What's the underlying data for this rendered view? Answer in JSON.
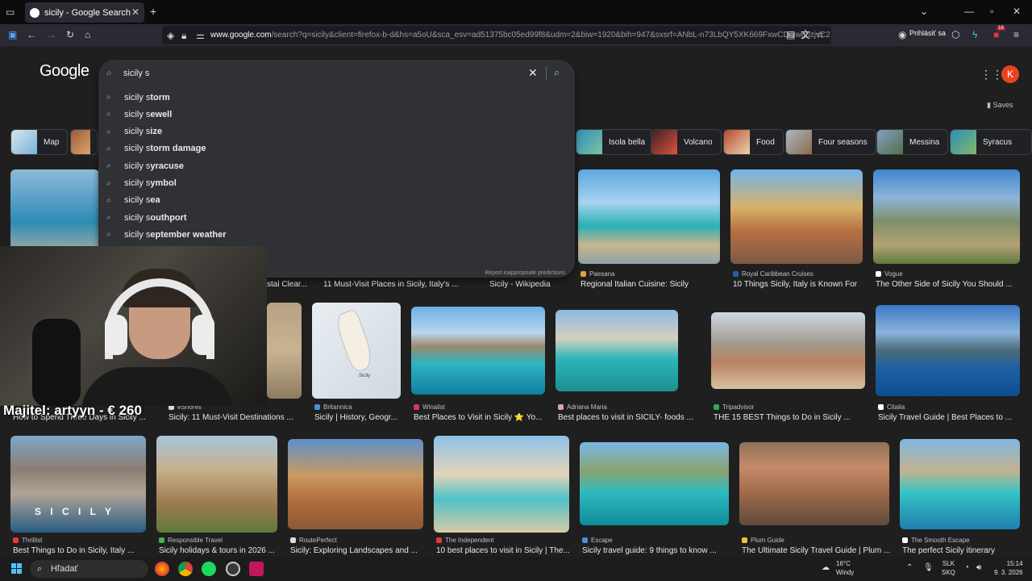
{
  "browser": {
    "tab_title": "sicily - Google Search",
    "url_host": "www.google.com",
    "url_rest": "/search?q=sicily&client=firefox-b-d&hs=a5oU&sca_esv=ad51375bc05ed99f8&udm=2&biw=1920&bih=947&sxsrf=ANbL-n73LbQY5XK669FxwCDi3wg0zjvC2",
    "signin_label": "Prihlásiť sa",
    "notif_count": "18"
  },
  "google": {
    "logo": "Google",
    "query": "sicily s",
    "saves_label": "Saves",
    "avatar_letter": "K",
    "report_label": "Report inappropriate predictions",
    "suggestions": [
      {
        "prefix": "sicily s",
        "bold": "torm"
      },
      {
        "prefix": "sicily s",
        "bold": "ewell"
      },
      {
        "prefix": "sicily s",
        "bold": "ize"
      },
      {
        "prefix": "sicily s",
        "bold": "torm damage"
      },
      {
        "prefix": "sicily s",
        "bold": "yracuse"
      },
      {
        "prefix": "sicily s",
        "bold": "ymbol"
      },
      {
        "prefix": "sicily s",
        "bold": "ea"
      },
      {
        "prefix": "sicily s",
        "bold": "outhport"
      },
      {
        "prefix": "sicily s",
        "bold": "eptember weather"
      }
    ],
    "chips": [
      "Map",
      "Isola bella",
      "Volcano",
      "Food",
      "Four seasons",
      "Messina",
      "Syracus"
    ]
  },
  "results_row1": [
    {
      "source": "",
      "title": "stal Clear..."
    },
    {
      "source": "",
      "title": "11 Must-Visit Places in Sicily, Italy's ..."
    },
    {
      "source": "",
      "title": "Sicily - Wikipedia"
    },
    {
      "source": "Paesana",
      "title": "Regional Italian Cuisine: Sicily"
    },
    {
      "source": "Royal Caribbean Cruises",
      "title": "10 Things Sicily, Italy is Known For"
    },
    {
      "source": "Vogue",
      "title": "The Other Side of Sicily You Should ..."
    }
  ],
  "results_row2": [
    {
      "source": "",
      "title": "How to Spend Three Days in Sicily ..."
    },
    {
      "source": "eShores",
      "title": "Sicily: 11 Must-Visit Destinations ..."
    },
    {
      "source": "Britannica",
      "title": "Sicily | History, Geogr..."
    },
    {
      "source": "Winalist",
      "title": "Best Places to Visit in Sicily ⭐ Yo..."
    },
    {
      "source": "Adriana Maria",
      "title": "Best places to visit in SICILY- foods ..."
    },
    {
      "source": "Tripadvisor",
      "title": "THE 15 BEST Things to Do in Sicily ..."
    },
    {
      "source": "Citalia",
      "title": "Sicily Travel Guide | Best Places to ..."
    }
  ],
  "results_row3": [
    {
      "source": "Thrillist",
      "title": "Best Things to Do in Sicily, Italy ..."
    },
    {
      "source": "Responsible Travel",
      "title": "Sicily holidays & tours in 2026 ..."
    },
    {
      "source": "RoutePerfect",
      "title": "Sicily: Exploring Landscapes and ..."
    },
    {
      "source": "The Independent",
      "title": "10 best places to visit in Sicily | The..."
    },
    {
      "source": "Escape",
      "title": "Sicily travel guide: 9 things to know ..."
    },
    {
      "source": "Plum Guide",
      "title": "The Ultimate Sicily Travel Guide | Plum ..."
    },
    {
      "source": "The Smooth Escape",
      "title": "The perfect Sicily itinerary"
    }
  ],
  "map_label": "Sicily",
  "sicily_overlay": "S I C I L Y",
  "overlay_owner": "Majitel: artyyn - € 260",
  "taskbar": {
    "search_placeholder": "Hľadať",
    "temp": "16°C",
    "weather": "Windy",
    "lang1": "SLK",
    "lang2": "SKQ",
    "time": "15:14",
    "date": "9. 3. 2026"
  }
}
